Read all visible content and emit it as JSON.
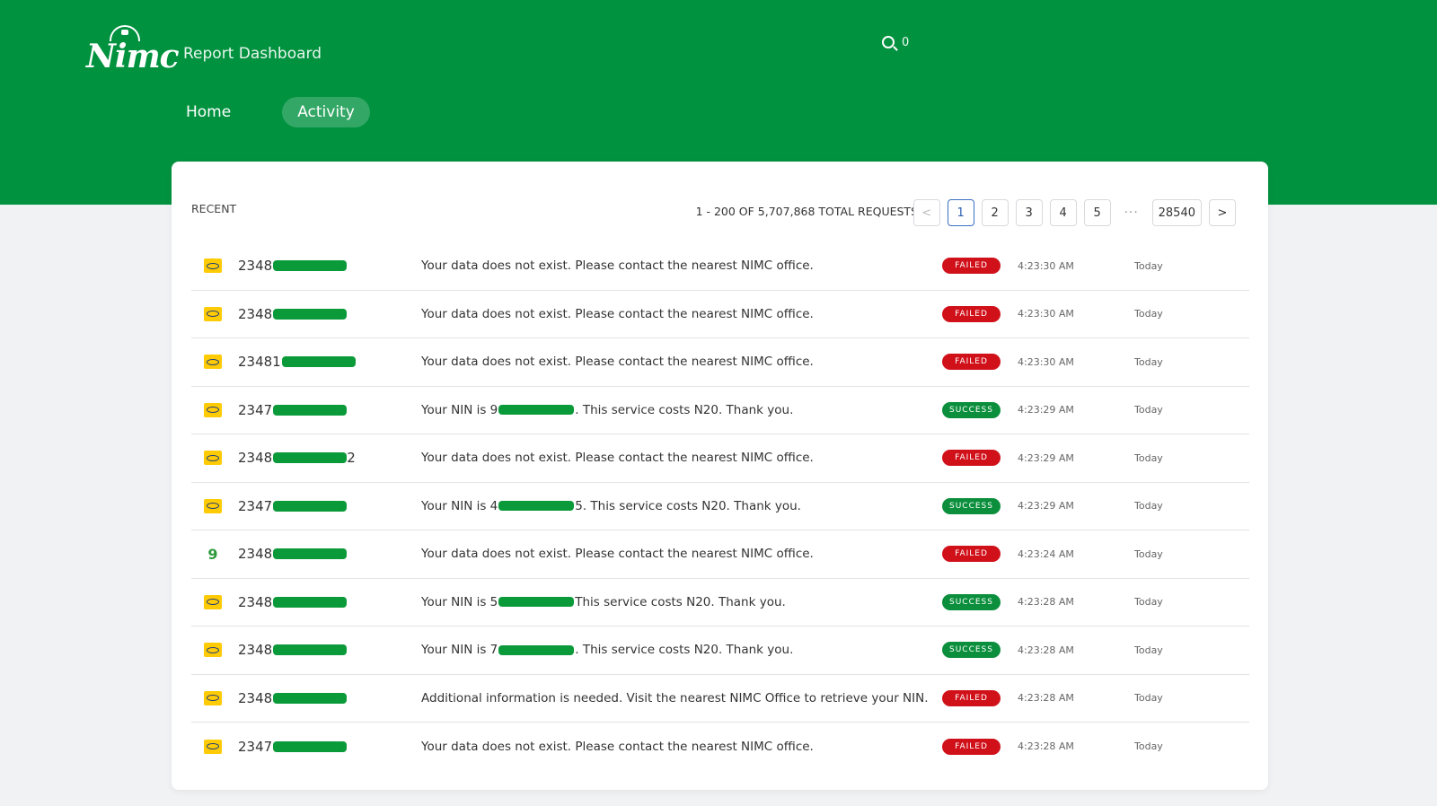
{
  "colors": {
    "brand_green": "#00923f",
    "failed_red": "#d0111a",
    "success_green": "#0b8f3d"
  },
  "header": {
    "logo_text": "Nimc",
    "app_title": "Report Dashboard",
    "search": {
      "icon": "search-icon",
      "value": "0"
    },
    "nav": [
      {
        "label": "Home",
        "active": false
      },
      {
        "label": "Activity",
        "active": true
      }
    ]
  },
  "panel": {
    "recent_label": "RECENT",
    "total_label": "1 - 200 OF 5,707,868 TOTAL REQUESTS",
    "pagination": {
      "prev": "<",
      "pages": [
        "1",
        "2",
        "3",
        "4",
        "5"
      ],
      "active": "1",
      "ellipsis": "···",
      "last": "28540",
      "next": ">"
    },
    "rows": [
      {
        "network": "mtn",
        "phone_prefix": "2348",
        "phone_suffix": "",
        "msg_pre": "Your data does not exist. Please contact the nearest NIMC office.",
        "msg_post": "",
        "status": "FAILED",
        "time": "4:23:30 AM",
        "day": "Today"
      },
      {
        "network": "mtn",
        "phone_prefix": "2348",
        "phone_suffix": "",
        "msg_pre": "Your data does not exist. Please contact the nearest NIMC office.",
        "msg_post": "",
        "status": "FAILED",
        "time": "4:23:30 AM",
        "day": "Today"
      },
      {
        "network": "mtn",
        "phone_prefix": "23481",
        "phone_suffix": "",
        "msg_pre": "Your data does not exist. Please contact the nearest NIMC office.",
        "msg_post": "",
        "status": "FAILED",
        "time": "4:23:30 AM",
        "day": "Today"
      },
      {
        "network": "mtn",
        "phone_prefix": "2347",
        "phone_suffix": "",
        "msg_pre": "Your NIN is 9",
        "msg_post": ". This service costs N20. Thank you.",
        "status": "SUCCESS",
        "time": "4:23:29 AM",
        "day": "Today"
      },
      {
        "network": "mtn",
        "phone_prefix": "2348",
        "phone_suffix": "2",
        "msg_pre": "Your data does not exist. Please contact the nearest NIMC office.",
        "msg_post": "",
        "status": "FAILED",
        "time": "4:23:29 AM",
        "day": "Today"
      },
      {
        "network": "mtn",
        "phone_prefix": "2347",
        "phone_suffix": "",
        "msg_pre": "Your NIN is 4",
        "msg_post": "5. This service costs N20. Thank you.",
        "status": "SUCCESS",
        "time": "4:23:29 AM",
        "day": "Today"
      },
      {
        "network": "9mobile",
        "phone_prefix": "2348",
        "phone_suffix": "",
        "msg_pre": "Your data does not exist. Please contact the nearest NIMC office.",
        "msg_post": "",
        "status": "FAILED",
        "time": "4:23:24 AM",
        "day": "Today"
      },
      {
        "network": "mtn",
        "phone_prefix": "2348",
        "phone_suffix": "",
        "msg_pre": "Your NIN is 5",
        "msg_post": "This service costs N20. Thank you.",
        "status": "SUCCESS",
        "time": "4:23:28 AM",
        "day": "Today"
      },
      {
        "network": "mtn",
        "phone_prefix": "2348",
        "phone_suffix": "",
        "msg_pre": "Your NIN is 7",
        "msg_post": ". This service costs N20. Thank you.",
        "status": "SUCCESS",
        "time": "4:23:28 AM",
        "day": "Today"
      },
      {
        "network": "mtn",
        "phone_prefix": "2348",
        "phone_suffix": "",
        "msg_pre": "Additional information is needed. Visit the nearest NIMC Office to retrieve your NIN.",
        "msg_post": "",
        "status": "FAILED",
        "time": "4:23:28 AM",
        "day": "Today"
      },
      {
        "network": "mtn",
        "phone_prefix": "2347",
        "phone_suffix": "",
        "msg_pre": "Your data does not exist. Please contact the nearest NIMC office.",
        "msg_post": "",
        "status": "FAILED",
        "time": "4:23:28 AM",
        "day": "Today"
      }
    ]
  }
}
